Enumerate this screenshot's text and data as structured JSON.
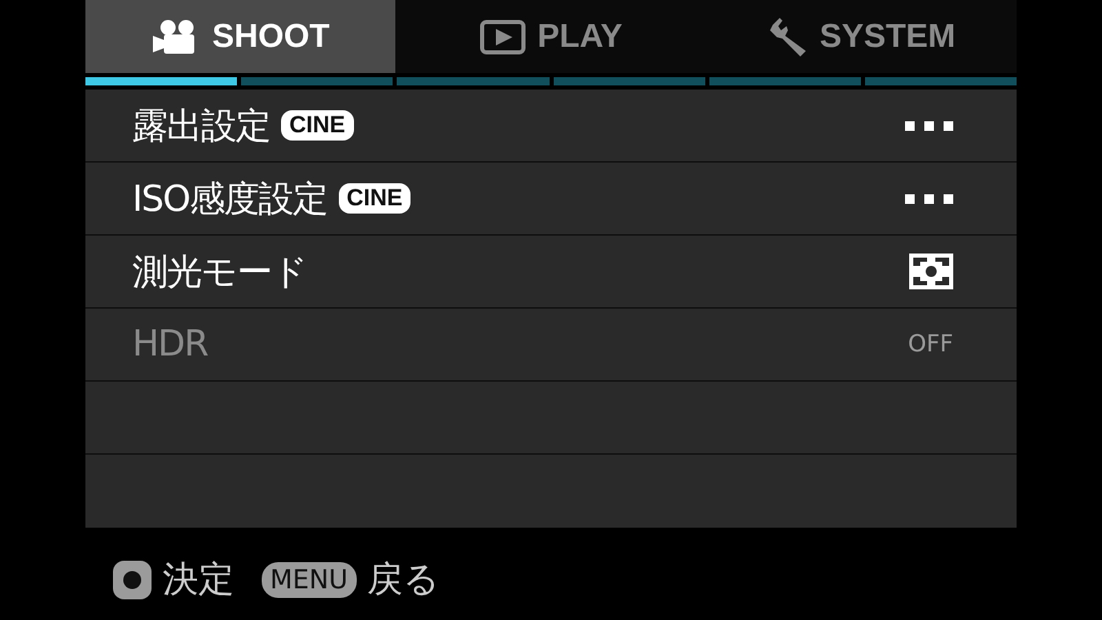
{
  "tabs": [
    {
      "label": "SHOOT",
      "selected": true
    },
    {
      "label": "PLAY",
      "selected": false
    },
    {
      "label": "SYSTEM",
      "selected": false
    }
  ],
  "pages": [
    {
      "selected": true
    },
    {
      "selected": false
    },
    {
      "selected": false
    },
    {
      "selected": false
    },
    {
      "selected": false
    },
    {
      "selected": false
    }
  ],
  "items": [
    {
      "label": "露出設定",
      "badge": "CINE",
      "kind": "more",
      "disabled": false
    },
    {
      "label": "ISO感度設定",
      "badge": "CINE",
      "kind": "more",
      "disabled": false
    },
    {
      "label": "測光モード",
      "kind": "metering",
      "disabled": false
    },
    {
      "label": "HDR",
      "kind": "text",
      "value": "OFF",
      "disabled": true
    }
  ],
  "footer": [
    {
      "kind": "round",
      "action": "決定"
    },
    {
      "kind": "label",
      "key": "MENU",
      "action": "戻る"
    }
  ]
}
